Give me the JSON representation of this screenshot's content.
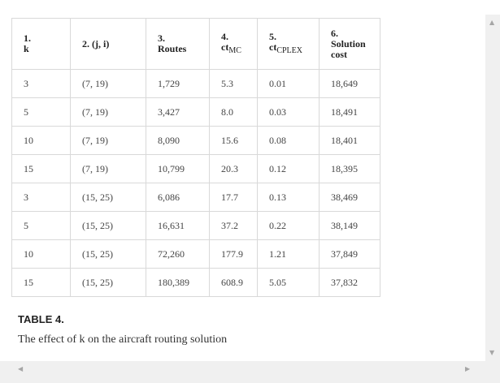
{
  "table": {
    "headers": [
      {
        "num": "1.",
        "label": "k"
      },
      {
        "num": "2. (j, i)",
        "label": ""
      },
      {
        "num": "3.",
        "label": "Routes"
      },
      {
        "num": "4.",
        "label": "ct",
        "sub": "MC"
      },
      {
        "num": "5.",
        "label": "ct",
        "sub": "CPLEX"
      },
      {
        "num": "6.",
        "label": "Solution cost"
      }
    ],
    "rows": [
      [
        "3",
        "(7, 19)",
        "1,729",
        "5.3",
        "0.01",
        "18,649"
      ],
      [
        "5",
        "(7, 19)",
        "3,427",
        "8.0",
        "0.03",
        "18,491"
      ],
      [
        "10",
        "(7, 19)",
        "8,090",
        "15.6",
        "0.08",
        "18,401"
      ],
      [
        "15",
        "(7, 19)",
        "10,799",
        "20.3",
        "0.12",
        "18,395"
      ],
      [
        "3",
        "(15, 25)",
        "6,086",
        "17.7",
        "0.13",
        "38,469"
      ],
      [
        "5",
        "(15, 25)",
        "16,631",
        "37.2",
        "0.22",
        "38,149"
      ],
      [
        "10",
        "(15, 25)",
        "72,260",
        "177.9",
        "1.21",
        "37,849"
      ],
      [
        "15",
        "(15, 25)",
        "180,389",
        "608.9",
        "5.05",
        "37,832"
      ]
    ]
  },
  "caption": {
    "title": "TABLE 4.",
    "text": "The effect of k on the aircraft routing solution"
  },
  "scrollbars": {
    "up_arrow": "▲",
    "down_arrow": "▼",
    "left_arrow": "◀",
    "right_arrow": "▶"
  }
}
